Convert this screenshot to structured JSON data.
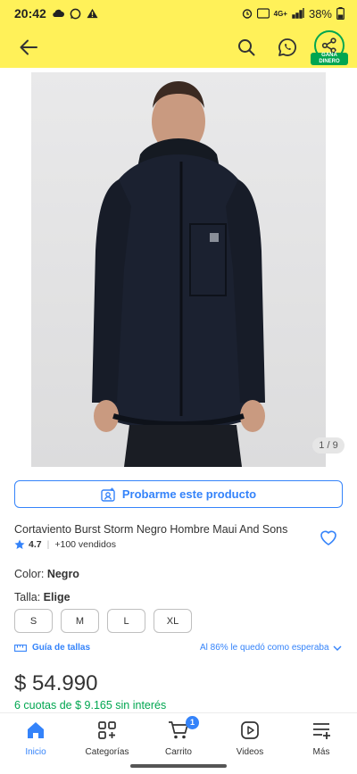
{
  "status_bar": {
    "time": "20:42",
    "network": "4G+",
    "battery": "38%"
  },
  "header": {
    "share_badge": "GANÁ DINERO"
  },
  "gallery": {
    "counter": "1 / 9"
  },
  "tryon": {
    "label": "Probarme este producto"
  },
  "product": {
    "title": "Cortaviento Burst Storm Negro Hombre Maui And Sons",
    "rating": "4.7",
    "sold": "+100 vendidos",
    "color_label": "Color:",
    "color_value": "Negro",
    "size_label": "Talla:",
    "size_value": "Elige",
    "sizes": [
      "S",
      "M",
      "L",
      "XL"
    ],
    "size_guide": "Guía de tallas",
    "fit_text": "Al 86% le quedó como esperaba",
    "price": "$ 54.990",
    "installments": "6 cuotas de $ 9.165 sin interés"
  },
  "nav": {
    "items": [
      {
        "label": "Inicio"
      },
      {
        "label": "Categorías"
      },
      {
        "label": "Carrito"
      },
      {
        "label": "Videos"
      },
      {
        "label": "Más"
      }
    ],
    "cart_count": "1"
  },
  "colors": {
    "brand_yellow": "#fff159",
    "accent_blue": "#3483fa",
    "success_green": "#00a650"
  }
}
